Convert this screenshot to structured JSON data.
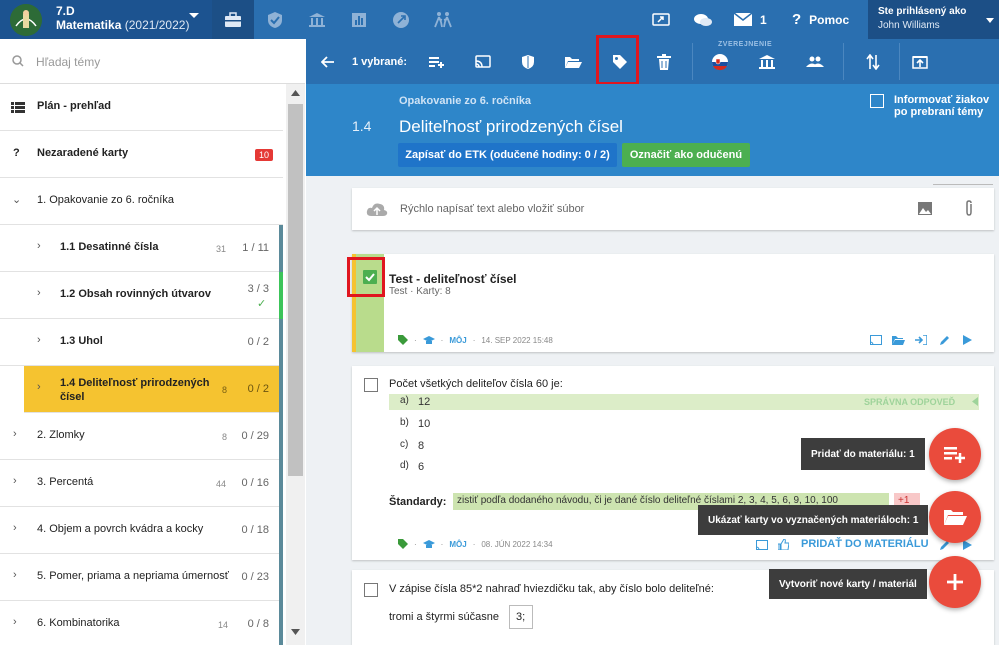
{
  "topbar": {
    "class_name": "7.D",
    "subject": "Matematika",
    "year": "(2021/2022)",
    "mail_count": "1",
    "help_label": "Pomoc",
    "user_title": "Ste prihlásený ako",
    "user_name": "John Williams"
  },
  "sidebar": {
    "search_placeholder": "Hľadaj témy",
    "plan_label": "Plán - prehľad",
    "unassigned_label": "Nezaradené karty",
    "unassigned_count": "10",
    "topics": [
      {
        "label": "1. Opakovanie zo 6. ročníka",
        "count": "",
        "progress": ""
      },
      {
        "label": "1.1  Desatinné čísla",
        "count": "31",
        "progress": "1 / 11"
      },
      {
        "label": "1.2  Obsah rovinných útvarov",
        "count": "",
        "progress": "3 / 3"
      },
      {
        "label": "1.3  Uhol",
        "count": "",
        "progress": "0 / 2"
      },
      {
        "label": "1.4  Deliteľnosť prirodzených čísel",
        "count": "8",
        "progress": "0 / 2"
      },
      {
        "label": "2. Zlomky",
        "count": "8",
        "progress": "0 / 29"
      },
      {
        "label": "3. Percentá",
        "count": "44",
        "progress": "0 / 16"
      },
      {
        "label": "4. Objem a povrch kvádra a kocky",
        "count": "",
        "progress": "0 / 18"
      },
      {
        "label": "5. Pomer, priama a nepriama úmernosť",
        "count": "",
        "progress": "0 / 23"
      },
      {
        "label": "6. Kombinatorika",
        "count": "14",
        "progress": "0 / 8"
      }
    ]
  },
  "toolbar": {
    "selected_label": "1 vybrané:",
    "publish_label": "ZVEREJNENIE"
  },
  "header": {
    "parent_topic": "Opakovanie zo 6. ročníka",
    "topic_number": "1.4",
    "topic_title": "Deliteľnosť prirodzených čísel",
    "etk_button": "Zapísať do ETK (odučené hodiny: 0 / 2)",
    "taught_button": "Označiť ako odučenú",
    "inform_label": "Informovať žiakov po prebraní témy"
  },
  "main": {
    "quick_write_placeholder": "Rýchlo napísať text alebo vložiť súbor",
    "cards": [
      {
        "title": "Test - deliteľnosť čísel",
        "subtitle": "Test · Karty: 8",
        "owner": "MÔJ",
        "date": "14. SEP 2022 15:48"
      },
      {
        "question": "Počet všetkých deliteľov čísla 60 je:",
        "answers": [
          {
            "letter": "a)",
            "text": "12"
          },
          {
            "letter": "b)",
            "text": "10"
          },
          {
            "letter": "c)",
            "text": "8"
          },
          {
            "letter": "d)",
            "text": "6"
          }
        ],
        "correct_label": "SPRÁVNA ODPOVEĎ",
        "standards_label": "Štandardy:",
        "standard_text": "zistiť podľa dodaného návodu, či je dané číslo deliteľné číslami 2, 3, 4, 5, 6, 9, 10, 100",
        "standard_extra": "+1",
        "owner": "MÔJ",
        "date": "08. JÚN 2022 14:34",
        "add_label": "PRIDAŤ DO MATERIÁLU"
      },
      {
        "question": "V zápise čísla 85*2 nahraď hviezdičku tak, aby číslo bolo deliteľné:",
        "line2": "tromi a štyrmi súčasne",
        "input_value": "3;"
      }
    ]
  },
  "tooltips": {
    "add_to_material": "Pridať do materiálu: 1",
    "show_cards": "Ukázať karty vo vyznačených materiáloch: 1",
    "create_new": "Vytvoriť nové karty / materiál"
  },
  "colors": {
    "topbar": "#2a6fb0",
    "header": "#2e86c9",
    "active_topic": "#f5c330",
    "fab": "#ea4b3c",
    "highlight": "#e0161f"
  }
}
